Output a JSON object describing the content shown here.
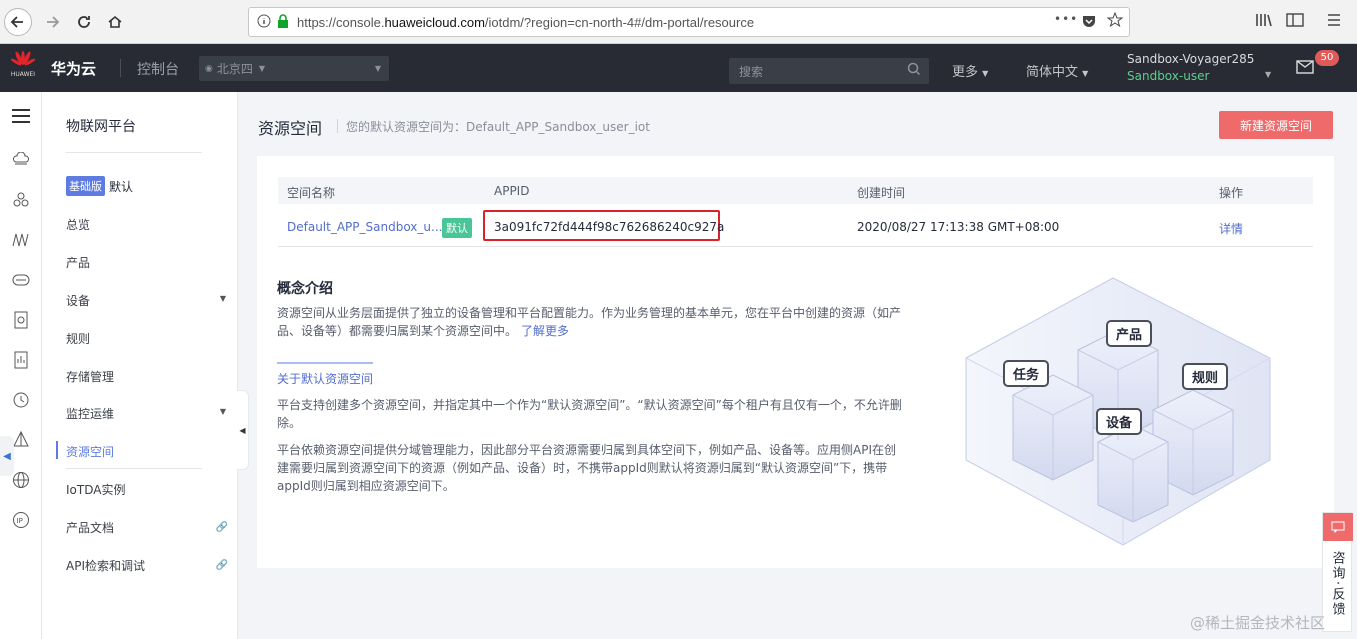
{
  "browser": {
    "url_prefix": "https://console.",
    "url_domain": "huaweicloud.com",
    "url_path": "/iotdm/?region=cn-north-4#/dm-portal/resource",
    "more": "•••"
  },
  "topnav": {
    "logo_text": "HUAWEI",
    "brand": "华为云",
    "console": "控制台",
    "region": "北京四",
    "search_placeholder": "搜索",
    "more": "更多",
    "language": "简体中文",
    "account_name": "Sandbox-Voyager285",
    "account_user": "Sandbox-user",
    "mail_count": "50"
  },
  "sidebar": {
    "title": "物联网平台",
    "edition_tag": "基础版",
    "edition_default": "默认",
    "items": [
      {
        "label": "总览"
      },
      {
        "label": "产品"
      },
      {
        "label": "设备"
      },
      {
        "label": "规则"
      },
      {
        "label": "存储管理"
      },
      {
        "label": "监控运维"
      },
      {
        "label": "资源空间"
      },
      {
        "label": "IoTDA实例"
      },
      {
        "label": "产品文档"
      },
      {
        "label": "API检索和调试"
      }
    ]
  },
  "header": {
    "title": "资源空间",
    "subtitle": "您的默认资源空间为：Default_APP_Sandbox_user_iot",
    "new_button": "新建资源空间"
  },
  "table": {
    "columns": [
      "空间名称",
      "APPID",
      "创建时间",
      "操作"
    ],
    "rows": [
      {
        "name": "Default_APP_Sandbox_u...",
        "tag": "默认",
        "appid": "3a091fc72fd444f98c762686240c927a",
        "created": "2020/08/27 17:13:38 GMT+08:00",
        "action": "详情"
      }
    ]
  },
  "concept": {
    "title": "概念介绍",
    "p1": "资源空间从业务层面提供了独立的设备管理和平台配置能力。作为业务管理的基本单元，您在平台中创建的资源（如产品、设备等）都需要归属到某个资源空间中。",
    "learn_more": "了解更多",
    "tab": "关于默认资源空间",
    "p2": "平台支持创建多个资源空间，并指定其中一个作为“默认资源空间”。“默认资源空间”每个租户有且仅有一个，不允许删除。",
    "p3": "平台依赖资源空间提供分域管理能力，因此部分平台资源需要归属到具体空间下，例如产品、设备等。应用侧API在创建需要归属到资源空间下的资源（例如产品、设备）时，不携带appId则默认将资源归属到“默认资源空间”下，携带appId则归属到相应资源空间下。"
  },
  "illustration": {
    "labels": [
      "产品",
      "任务",
      "规则",
      "设备"
    ]
  },
  "feedback": {
    "label": "咨询·反馈"
  },
  "watermark": "@稀土掘金技术社区"
}
